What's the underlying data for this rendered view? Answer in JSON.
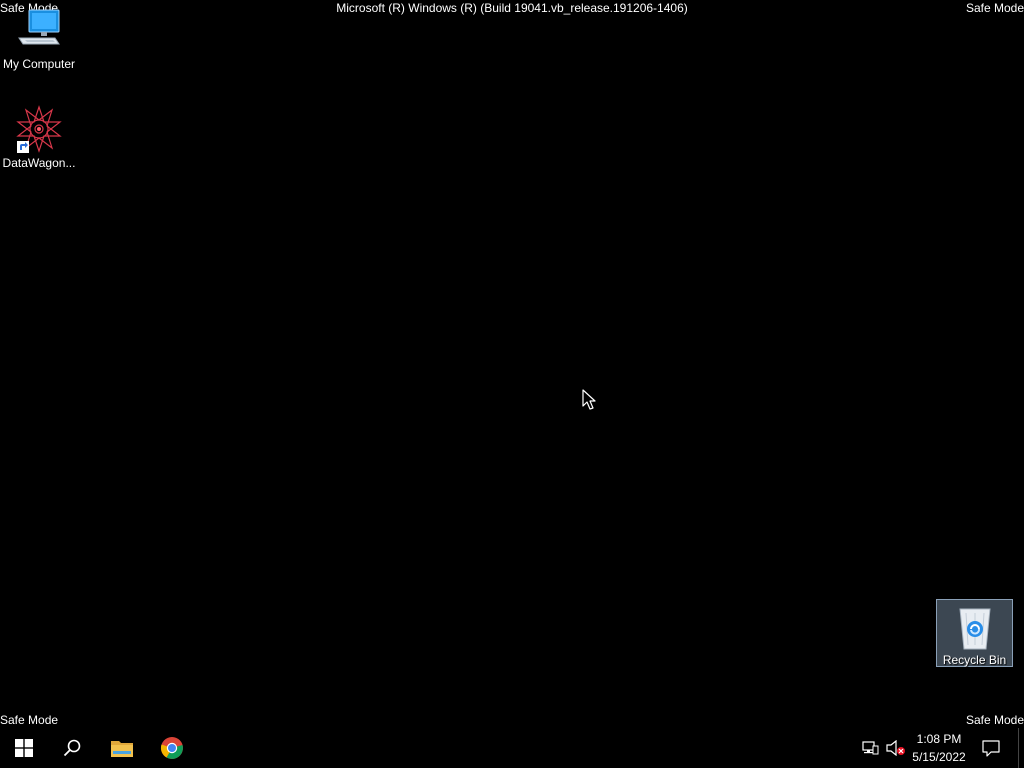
{
  "watermark": {
    "top_left": "Safe Mode",
    "top_right": "Safe Mode",
    "bottom_left": "Safe Mode",
    "bottom_right": "Safe Mode",
    "build": "Microsoft (R) Windows (R) (Build 19041.vb_release.191206-1406)"
  },
  "desktop": {
    "icons": [
      {
        "label": "My Computer",
        "icon": "computer-icon"
      },
      {
        "label": "DataWagon...",
        "icon": "datawagon-icon",
        "shortcut": true
      },
      {
        "label": "Recycle Bin",
        "icon": "recycle-bin-icon",
        "selected": true
      }
    ]
  },
  "taskbar": {
    "buttons": [
      "start-icon",
      "search-icon",
      "file-explorer-icon",
      "chrome-icon"
    ],
    "tray": {
      "icons": [
        "network-icon",
        "volume-muted-icon"
      ],
      "time": "1:08 PM",
      "date": "5/15/2022",
      "notification_icon": "action-center-icon"
    }
  },
  "colors": {
    "background": "#000000",
    "selection": "#6e8296",
    "start": "#ffffff",
    "folder": "#f2c14e"
  }
}
